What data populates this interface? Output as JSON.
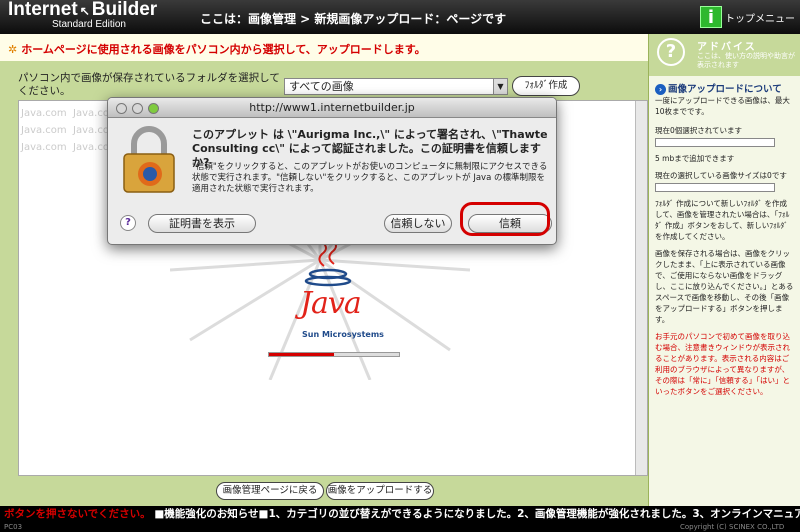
{
  "header": {
    "logo": "Internet",
    "logo2": "Builder",
    "edition": "Standard Edition",
    "title": "ここは：画像管理 > 新規画像アップロード：ページです",
    "top_menu": "トップメニュー",
    "top_menu_icon": "i"
  },
  "notice": "ホームページに使用される画像をパソコン内から選択して、アップロードします。",
  "folder": {
    "label": "パソコン内で画像が保存されているフォルダを選択してください。",
    "selected": "すべての画像",
    "create_button": "ﾌｫﾙﾀﾞ作成"
  },
  "ghost_text": "Java.com  Java.com  Java.com\nJava.com  Java.com  Java.com\nJava.com  Java.com  Java.com",
  "java": {
    "word": "Java",
    "sub": "Sun Microsystems",
    "progress": 0.5
  },
  "bottom": {
    "back": "画像管理ページに戻る",
    "upload": "画像をアップロードする"
  },
  "dialog": {
    "title": "http://www1.internetbuilder.jp",
    "message": "このアプレット は \\\"Aurigma Inc.,\\\" によって署名され、\\\"Thawte Consulting cc\\\" によって認証されました。この証明書を信頼しますか?",
    "detail": "\"信頼\"をクリックすると、このアプレットがお使いのコンピュータに無制限にアクセスできる状態で実行されます。\"信頼しない\"をクリックすると、このアプレットが Java の標準制限を適用された状態で実行されます。",
    "help": "?",
    "cert_button": "証明書を表示",
    "deny_button": "信頼しない",
    "trust_button": "信頼"
  },
  "advice": {
    "icon": "?",
    "title": "アドバイス",
    "desc": "ここは、使い方の説明や助言が表示されます",
    "section_title": "画像アップロードについて",
    "max_text": "一度にアップロードできる画像は、最大10枚までです。",
    "current_images": "現在0個選択されています",
    "add_text": "5 mbまで追加できます",
    "size_text": "現在の選択している画像サイズは0です",
    "folder_text": "ﾌｫﾙﾀﾞ 作成について新しいﾌｫﾙﾀﾞ を作成して、画像を管理されたい場合は、「ﾌｫﾙﾀﾞ 作成」ボタンをおして、新しいﾌｫﾙﾀﾞ を作成してください。",
    "drag_text": "画像を保存される場合は、画像をクリックしたまま、「上に表示されている画像で、ご使用にならない画像をドラッグし、ここに放り込んでください。」とあるスペースで画像を移動し、その後「画像をアップロードする」ボタンを押します。",
    "warn_text": "お手元のパソコンで初めて画像を取り込む場合、注意書きウィンドウが表示されることがあります。表示される内容はご利用のブラウザによって異なりますが、その際は「常に」「信頼する」「はい」といったボタンをご選択ください。"
  },
  "ticker": {
    "red": "ボタンを押さないでください。",
    "text": "■機能強化のお知らせ■1、カテゴリの並び替えができるようになりました。2、画像管理機能が強化されました。3、オンラインマニュア"
  },
  "footer": {
    "left": "PC03",
    "right": "Copyright (C) SCINEX CO.,LTD"
  }
}
